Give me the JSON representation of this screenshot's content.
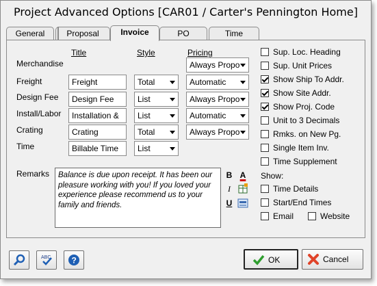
{
  "window": {
    "title": "Project Advanced Options [CAR01 / Carter's Pennington Home]"
  },
  "tabs": [
    {
      "label": "General",
      "active": false
    },
    {
      "label": "Proposal",
      "active": false
    },
    {
      "label": "Invoice",
      "active": true
    },
    {
      "label": "PO",
      "active": false
    },
    {
      "label": "Time",
      "active": false
    }
  ],
  "columns": {
    "title": "Title",
    "style": "Style",
    "pricing": "Pricing"
  },
  "rows": [
    {
      "label": "Merchandise",
      "title": null,
      "style": null,
      "pricing": "Always Propo"
    },
    {
      "label": "Freight",
      "title": "Freight",
      "style": "Total",
      "pricing": "Automatic"
    },
    {
      "label": "Design Fee",
      "title": "Design Fee",
      "style": "List",
      "pricing": "Always Propo"
    },
    {
      "label": "Install/Labor",
      "title": "Installation &",
      "style": "List",
      "pricing": "Automatic"
    },
    {
      "label": "Crating",
      "title": "Crating",
      "style": "Total",
      "pricing": "Always Propo"
    },
    {
      "label": "Time",
      "title": "Billable Time",
      "style": "List",
      "pricing": null
    }
  ],
  "remarks": {
    "label": "Remarks",
    "text": "Balance is due upon receipt.  It has been our pleasure working with you!  If you loved your experience please recommend us to your family and friends."
  },
  "format_buttons": {
    "bold": "B",
    "italic": "I",
    "underline": "U",
    "font_color": "A"
  },
  "options": [
    {
      "label": "Sup. Loc. Heading",
      "checked": false
    },
    {
      "label": "Sup. Unit Prices",
      "checked": false
    },
    {
      "label": "Show Ship To Addr.",
      "checked": true
    },
    {
      "label": "Show Site Addr.",
      "checked": true
    },
    {
      "label": "Show Proj. Code",
      "checked": true
    },
    {
      "label": "Unit to 3 Decimals",
      "checked": false
    },
    {
      "label": "Rmks. on New Pg.",
      "checked": false
    },
    {
      "label": "Single Item Inv.",
      "checked": false
    },
    {
      "label": "Time Supplement",
      "checked": false
    }
  ],
  "show": {
    "label": "Show:",
    "items": [
      {
        "label": "Time Details",
        "checked": false
      },
      {
        "label": "Start/End Times",
        "checked": false
      },
      {
        "label": "Email",
        "checked": false
      },
      {
        "label": "Website",
        "checked": false
      }
    ]
  },
  "buttons": {
    "ok": "OK",
    "cancel": "Cancel"
  },
  "spell_icon_text": "ABC",
  "colors": {
    "ok_check": "#2e9d2e",
    "cancel_x": "#e0442a",
    "help_blue": "#1e5fb4",
    "font_color_red": "#d01010"
  }
}
